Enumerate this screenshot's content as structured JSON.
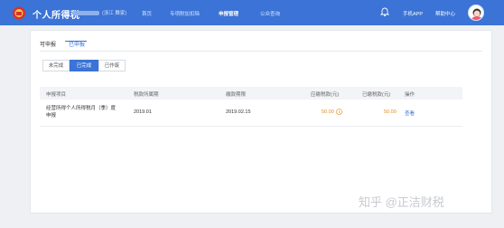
{
  "header": {
    "title": "个人所得税",
    "user_text": "(浙江 舞家)",
    "nav": [
      "首页",
      "专项附加扣除",
      "申报管理",
      "公众查询"
    ],
    "active_nav": "申报管理",
    "mobile_app": "手机APP",
    "help_center": "帮助中心"
  },
  "tabs": [
    {
      "label": "可申报",
      "active": false
    },
    {
      "label": "已申报",
      "active": true
    }
  ],
  "filters": [
    {
      "label": "未完成",
      "active": false
    },
    {
      "label": "已完成",
      "active": true
    },
    {
      "label": "已作废",
      "active": false
    }
  ],
  "table": {
    "headers": [
      "申报项目",
      "税款所属期",
      "缴款期限",
      "应缴税款(元)",
      "已缴税款(元)",
      "操作"
    ],
    "rows": [
      {
        "item": "经营所得个人所得税月（季）度申报",
        "period": "2019.01",
        "deadline": "2019.02.15",
        "tax_due": "50.00",
        "tax_paid": "50.00",
        "action": "查看"
      }
    ]
  },
  "watermark": "知乎 @正洁财税",
  "colors": {
    "brand": "#3b73d6",
    "amount": "#e08a1e"
  }
}
